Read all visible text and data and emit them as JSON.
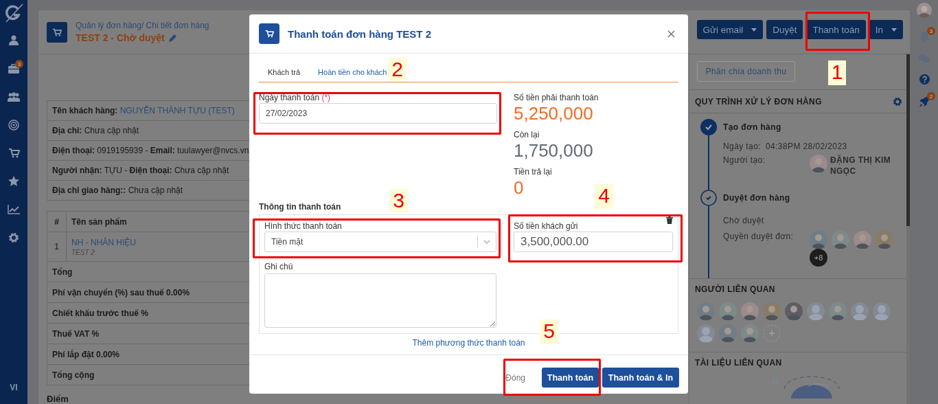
{
  "sidebar": {
    "jobs_badge": "3",
    "language": "VI"
  },
  "header": {
    "breadcrumb": "Quản lý đơn hàng/ Chi tiết đơn hàng",
    "title": "TEST 2 - Chờ duyệt"
  },
  "actions": [
    {
      "label": "Gửi email",
      "dropdown": true
    },
    {
      "label": "Duyệt",
      "dropdown": false
    },
    {
      "label": "Thanh toán",
      "dropdown": false
    },
    {
      "label": "In",
      "dropdown": true
    }
  ],
  "customer": [
    {
      "text": "**Tên khách hàng:** NGUYỄN THÀNH TỰU (TEST)",
      "link": true
    },
    {
      "text": "**Địa chỉ:** Chưa cập nhật",
      "link": false
    },
    {
      "text": "**Điện thoại:** 0919195939 - **Email:** tuulawyer@nvcs.vn",
      "link": false
    },
    {
      "text": "**Người nhận:** TỰU - **Điện thoại:** Chưa cập nhật",
      "link": false
    },
    {
      "text": "**Địa chỉ giao hàng::** Chưa cập nhật",
      "link": false
    }
  ],
  "products": {
    "columns": [
      "#",
      "Tên sản phẩm"
    ],
    "rows": [
      {
        "index": "1",
        "name": "NH - NHÃN HIỆU",
        "note": "TEST 2"
      }
    ]
  },
  "summary": [
    "Tổng",
    "Phí vận chuyển (%) sau thuế 0.00%",
    "Chiết khấu trước thuế %",
    "Thuế VAT %",
    "Phí lắp đặt 0.00%",
    "Tổng cộng"
  ],
  "points_label": "Điểm",
  "revenue_button": "Phân chia doanh thu",
  "workflow": {
    "title": "QUY TRÌNH XỬ LÝ ĐƠN HÀNG",
    "steps": [
      {
        "kind": "created",
        "title": "Tạo đơn hàng",
        "done": true,
        "date_label": "Ngày tạo:",
        "date_value": "04:38PM 28/02/2023",
        "creator_label": "Người tạo:",
        "creator_name": "ĐẶNG THỊ KIM NGỌC"
      },
      {
        "kind": "approval",
        "title": "Duyệt đơn hàng",
        "done": false,
        "status": "Chờ duyệt",
        "approvers_label": "Quyền duyệt đơn:",
        "approvers": [
          {
            "kind": "photo"
          },
          {
            "kind": "photo"
          },
          {
            "kind": "photo"
          },
          {
            "kind": "photo"
          }
        ],
        "more": "+8"
      }
    ]
  },
  "related_people": {
    "title": "NGƯỜI LIÊN QUAN",
    "people": [
      {
        "kind": "photo"
      },
      {
        "kind": "photo"
      },
      {
        "kind": "photo"
      },
      {
        "kind": "photo"
      },
      {
        "kind": "photo"
      },
      {
        "kind": "placeholder"
      },
      {
        "kind": "photo"
      },
      {
        "kind": "placeholder"
      },
      {
        "kind": "placeholder"
      },
      {
        "kind": "placeholder"
      },
      {
        "kind": "photo"
      },
      {
        "kind": "photo"
      },
      {
        "kind": "add"
      }
    ]
  },
  "documents": {
    "title": "TÀI LIỆU LIÊN QUAN"
  },
  "rail": {
    "notifications_badge": "3",
    "launch_badge": "2"
  },
  "modal": {
    "title": "Thanh toán đơn hàng TEST 2",
    "tabs": [
      {
        "label": "Khách trả",
        "selected": true
      },
      {
        "label": "Hoàn tiền cho khách",
        "selected": false
      }
    ],
    "date": {
      "label": "Ngày thanh toán",
      "required": "(*)",
      "value": "27/02/2023"
    },
    "amounts": [
      {
        "label": "Số tiền phải thanh toán",
        "value": "5,250,000",
        "color": "#f26b22"
      },
      {
        "label": "Còn lại",
        "value": "1,750,000",
        "color": "#5f6a76"
      },
      {
        "label": "Tiền trả lại",
        "value": "0",
        "color": "#f26b22"
      }
    ],
    "section_title": "Thông tin thanh toán",
    "method": {
      "label": "Hình thức thanh toán",
      "value": "Tiền mặt"
    },
    "received": {
      "label": "Số tiền khách gửi",
      "value": "3,500,000.00"
    },
    "note": {
      "label": "Ghi chú"
    },
    "add_method": "Thêm phương thức thanh toán",
    "close": "Đóng",
    "buttons": [
      "Thanh toán",
      "Thanh toán & In"
    ]
  },
  "annotations": [
    {
      "label": "1"
    },
    {
      "label": "2"
    },
    {
      "label": "3"
    },
    {
      "label": "4"
    },
    {
      "label": "5"
    }
  ]
}
